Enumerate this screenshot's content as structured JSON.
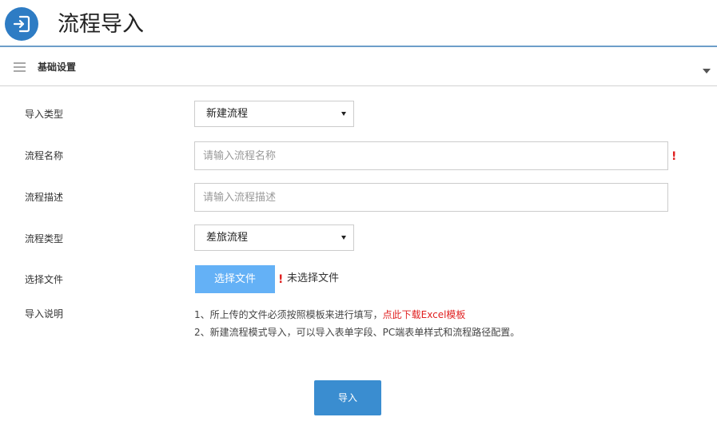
{
  "header": {
    "icon": "import-icon",
    "title": "流程导入",
    "accent_color": "#2e7cc4"
  },
  "section": {
    "icon": "menu-icon",
    "title": "基础设置",
    "collapse_icon": "caret-down-icon"
  },
  "form": {
    "import_type": {
      "label": "导入类型",
      "value": "新建流程"
    },
    "flow_name": {
      "label": "流程名称",
      "placeholder": "请输入流程名称",
      "required_mark": "!"
    },
    "flow_desc": {
      "label": "流程描述",
      "placeholder": "请输入流程描述"
    },
    "flow_type": {
      "label": "流程类型",
      "value": "差旅流程"
    },
    "file": {
      "label": "选择文件",
      "button_label": "选择文件",
      "required_mark": "!",
      "status": "未选择文件"
    },
    "notes": {
      "label": "导入说明",
      "line1_text": "1、所上传的文件必须按照模板来进行填写，",
      "line1_link": "点此下载Excel模板",
      "line2_text": "2、新建流程模式导入，可以导入表单字段、PC端表单样式和流程路径配置。"
    }
  },
  "actions": {
    "submit_label": "导入",
    "submit_color": "#3a8dd0"
  },
  "colors": {
    "file_button": "#64b1f6",
    "required": "#e02020",
    "link": "#e02020"
  }
}
